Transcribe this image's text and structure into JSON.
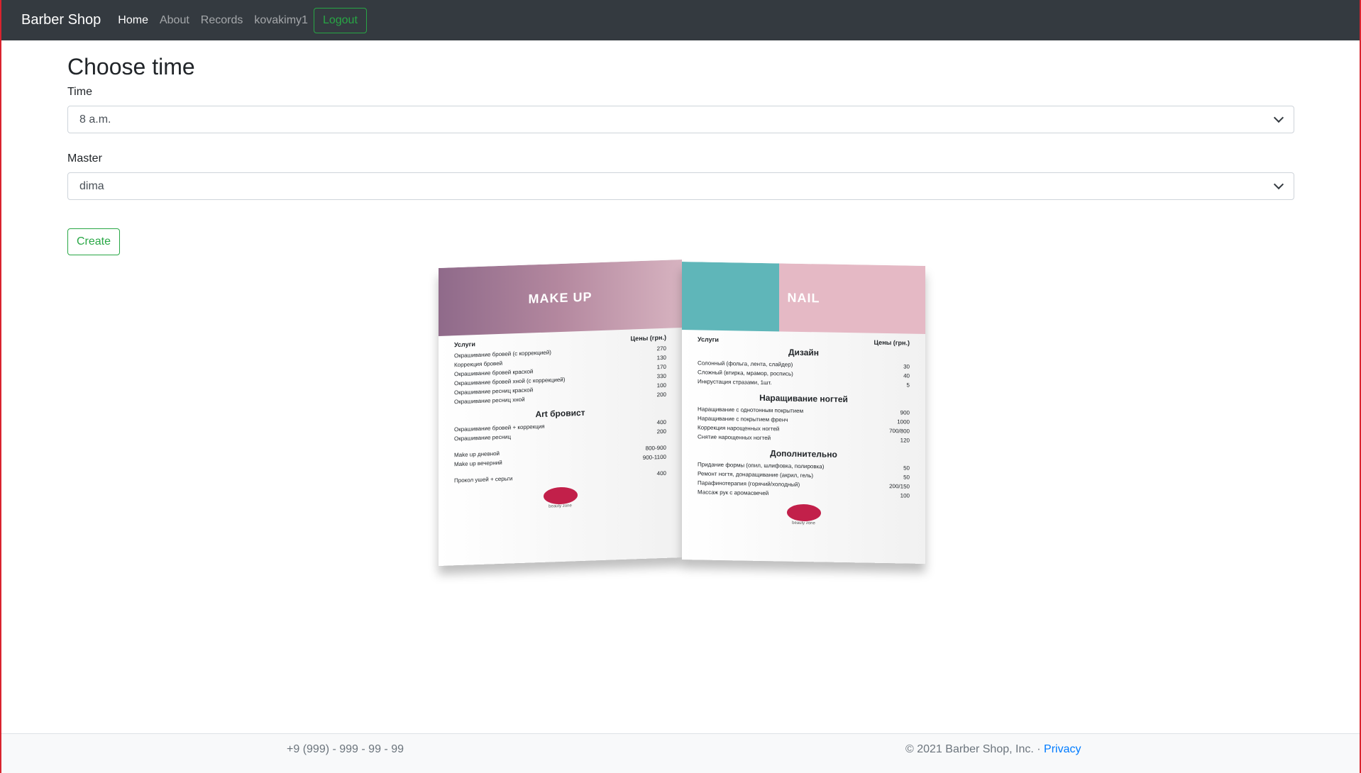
{
  "navbar": {
    "brand": "Barber Shop",
    "links": [
      "Home",
      "About",
      "Records",
      "kovakimy1"
    ],
    "logout": "Logout"
  },
  "form": {
    "title": "Choose time",
    "time_label": "Time",
    "time_value": "8 a.m.",
    "master_label": "Master",
    "master_value": "dima",
    "create": "Create"
  },
  "brochure": {
    "left_title": "MAKE UP",
    "right_title": "NAIL",
    "services": "Услуги",
    "prices": "Цены (грн.)",
    "left_items": [
      [
        "Окрашивание бровей (с коррекцией)",
        "270"
      ],
      [
        "Коррекция бровей",
        "130"
      ],
      [
        "Окрашивание бровей краской",
        "170"
      ],
      [
        "Окрашивание бровей хной (с коррекцией)",
        "330"
      ],
      [
        "Окрашивание ресниц краской",
        "100"
      ],
      [
        "Окрашивание ресниц хной",
        "200"
      ]
    ],
    "left_section": "Art бровист",
    "left_items2": [
      [
        "Окрашивание бровей + коррекция",
        "400"
      ],
      [
        "Окрашивание ресниц",
        "200"
      ],
      [
        "Make up дневной",
        "800-900"
      ],
      [
        "Make up вечерний",
        "900-1100"
      ],
      [
        "Прокол ушей + серьги",
        "400"
      ]
    ],
    "right_section1": "Дизайн",
    "right_items1": [
      [
        "Солонный (фольга, лента, слайдер)",
        "30"
      ],
      [
        "Сложный (втирка, мрамор, роспись)",
        "40"
      ],
      [
        "Инкрустация стразами, 1шт.",
        "5"
      ]
    ],
    "right_section2": "Наращивание ногтей",
    "right_items2": [
      [
        "Наращивание с однотонным покрытием",
        "900"
      ],
      [
        "Наращивание с покрытием френч",
        "1000"
      ],
      [
        "Коррекция нарощенных ногтей",
        "700/800"
      ],
      [
        "Снятие нарощенных ногтей",
        "120"
      ]
    ],
    "right_section3": "Дополнительно",
    "right_items3": [
      [
        "Придание формы (опил, шлифовка, полировка)",
        "50"
      ],
      [
        "Ремонт ногтя, донаращивание (акрил, гель)",
        "50"
      ],
      [
        "Парафинотерапия (горячий/холодный)",
        "200/150"
      ],
      [
        "Массаж рук с аромасвечей",
        "100"
      ]
    ],
    "tagline": "beauty zone"
  },
  "footer": {
    "phone": "+9 (999) - 999 - 99 - 99",
    "copyright": "© 2021 Barber Shop, Inc. · ",
    "privacy": "Privacy"
  }
}
